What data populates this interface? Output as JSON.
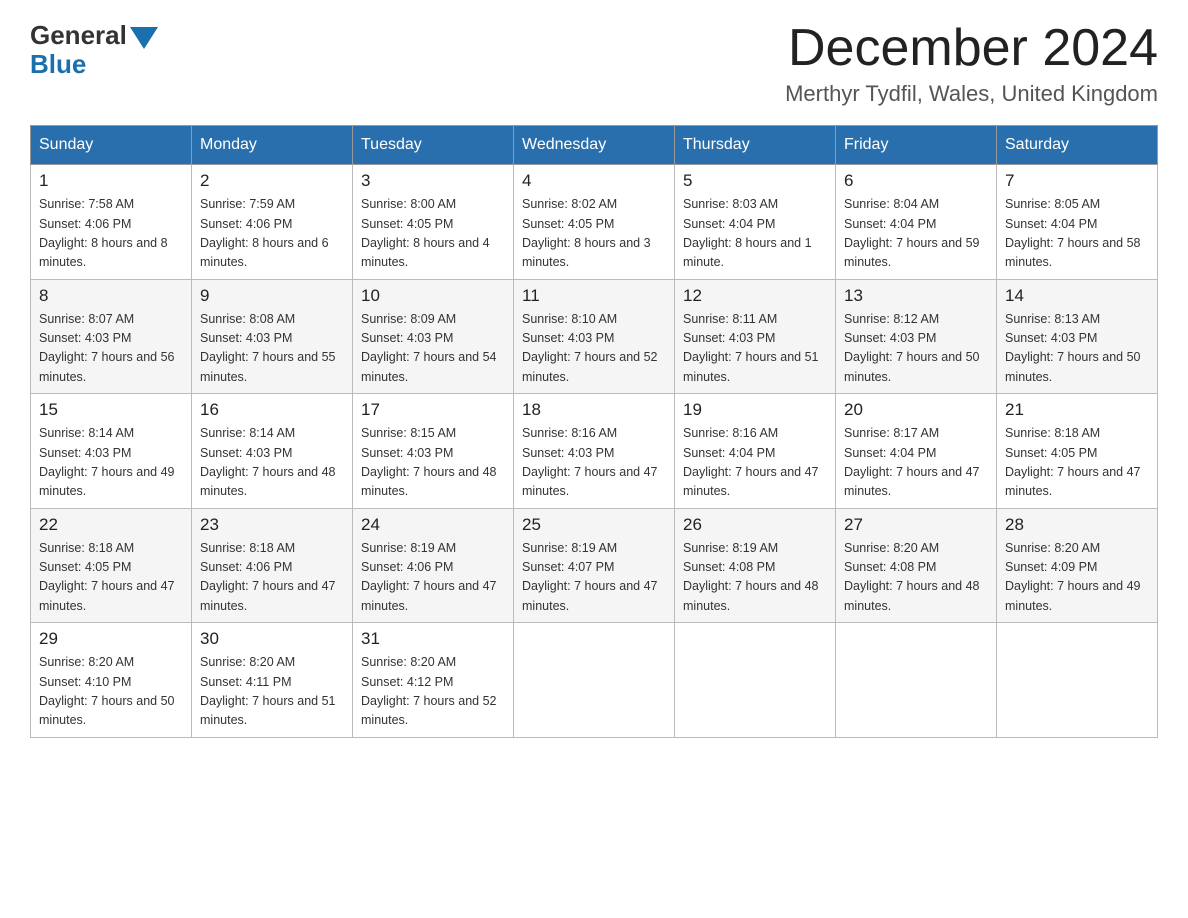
{
  "header": {
    "logo": {
      "general": "General",
      "blue": "Blue"
    },
    "title": "December 2024",
    "subtitle": "Merthyr Tydfil, Wales, United Kingdom"
  },
  "weekdays": [
    "Sunday",
    "Monday",
    "Tuesday",
    "Wednesday",
    "Thursday",
    "Friday",
    "Saturday"
  ],
  "weeks": [
    [
      {
        "day": "1",
        "sunrise": "7:58 AM",
        "sunset": "4:06 PM",
        "daylight": "8 hours and 8 minutes."
      },
      {
        "day": "2",
        "sunrise": "7:59 AM",
        "sunset": "4:06 PM",
        "daylight": "8 hours and 6 minutes."
      },
      {
        "day": "3",
        "sunrise": "8:00 AM",
        "sunset": "4:05 PM",
        "daylight": "8 hours and 4 minutes."
      },
      {
        "day": "4",
        "sunrise": "8:02 AM",
        "sunset": "4:05 PM",
        "daylight": "8 hours and 3 minutes."
      },
      {
        "day": "5",
        "sunrise": "8:03 AM",
        "sunset": "4:04 PM",
        "daylight": "8 hours and 1 minute."
      },
      {
        "day": "6",
        "sunrise": "8:04 AM",
        "sunset": "4:04 PM",
        "daylight": "7 hours and 59 minutes."
      },
      {
        "day": "7",
        "sunrise": "8:05 AM",
        "sunset": "4:04 PM",
        "daylight": "7 hours and 58 minutes."
      }
    ],
    [
      {
        "day": "8",
        "sunrise": "8:07 AM",
        "sunset": "4:03 PM",
        "daylight": "7 hours and 56 minutes."
      },
      {
        "day": "9",
        "sunrise": "8:08 AM",
        "sunset": "4:03 PM",
        "daylight": "7 hours and 55 minutes."
      },
      {
        "day": "10",
        "sunrise": "8:09 AM",
        "sunset": "4:03 PM",
        "daylight": "7 hours and 54 minutes."
      },
      {
        "day": "11",
        "sunrise": "8:10 AM",
        "sunset": "4:03 PM",
        "daylight": "7 hours and 52 minutes."
      },
      {
        "day": "12",
        "sunrise": "8:11 AM",
        "sunset": "4:03 PM",
        "daylight": "7 hours and 51 minutes."
      },
      {
        "day": "13",
        "sunrise": "8:12 AM",
        "sunset": "4:03 PM",
        "daylight": "7 hours and 50 minutes."
      },
      {
        "day": "14",
        "sunrise": "8:13 AM",
        "sunset": "4:03 PM",
        "daylight": "7 hours and 50 minutes."
      }
    ],
    [
      {
        "day": "15",
        "sunrise": "8:14 AM",
        "sunset": "4:03 PM",
        "daylight": "7 hours and 49 minutes."
      },
      {
        "day": "16",
        "sunrise": "8:14 AM",
        "sunset": "4:03 PM",
        "daylight": "7 hours and 48 minutes."
      },
      {
        "day": "17",
        "sunrise": "8:15 AM",
        "sunset": "4:03 PM",
        "daylight": "7 hours and 48 minutes."
      },
      {
        "day": "18",
        "sunrise": "8:16 AM",
        "sunset": "4:03 PM",
        "daylight": "7 hours and 47 minutes."
      },
      {
        "day": "19",
        "sunrise": "8:16 AM",
        "sunset": "4:04 PM",
        "daylight": "7 hours and 47 minutes."
      },
      {
        "day": "20",
        "sunrise": "8:17 AM",
        "sunset": "4:04 PM",
        "daylight": "7 hours and 47 minutes."
      },
      {
        "day": "21",
        "sunrise": "8:18 AM",
        "sunset": "4:05 PM",
        "daylight": "7 hours and 47 minutes."
      }
    ],
    [
      {
        "day": "22",
        "sunrise": "8:18 AM",
        "sunset": "4:05 PM",
        "daylight": "7 hours and 47 minutes."
      },
      {
        "day": "23",
        "sunrise": "8:18 AM",
        "sunset": "4:06 PM",
        "daylight": "7 hours and 47 minutes."
      },
      {
        "day": "24",
        "sunrise": "8:19 AM",
        "sunset": "4:06 PM",
        "daylight": "7 hours and 47 minutes."
      },
      {
        "day": "25",
        "sunrise": "8:19 AM",
        "sunset": "4:07 PM",
        "daylight": "7 hours and 47 minutes."
      },
      {
        "day": "26",
        "sunrise": "8:19 AM",
        "sunset": "4:08 PM",
        "daylight": "7 hours and 48 minutes."
      },
      {
        "day": "27",
        "sunrise": "8:20 AM",
        "sunset": "4:08 PM",
        "daylight": "7 hours and 48 minutes."
      },
      {
        "day": "28",
        "sunrise": "8:20 AM",
        "sunset": "4:09 PM",
        "daylight": "7 hours and 49 minutes."
      }
    ],
    [
      {
        "day": "29",
        "sunrise": "8:20 AM",
        "sunset": "4:10 PM",
        "daylight": "7 hours and 50 minutes."
      },
      {
        "day": "30",
        "sunrise": "8:20 AM",
        "sunset": "4:11 PM",
        "daylight": "7 hours and 51 minutes."
      },
      {
        "day": "31",
        "sunrise": "8:20 AM",
        "sunset": "4:12 PM",
        "daylight": "7 hours and 52 minutes."
      },
      null,
      null,
      null,
      null
    ]
  ],
  "labels": {
    "sunrise": "Sunrise:",
    "sunset": "Sunset:",
    "daylight": "Daylight:"
  }
}
